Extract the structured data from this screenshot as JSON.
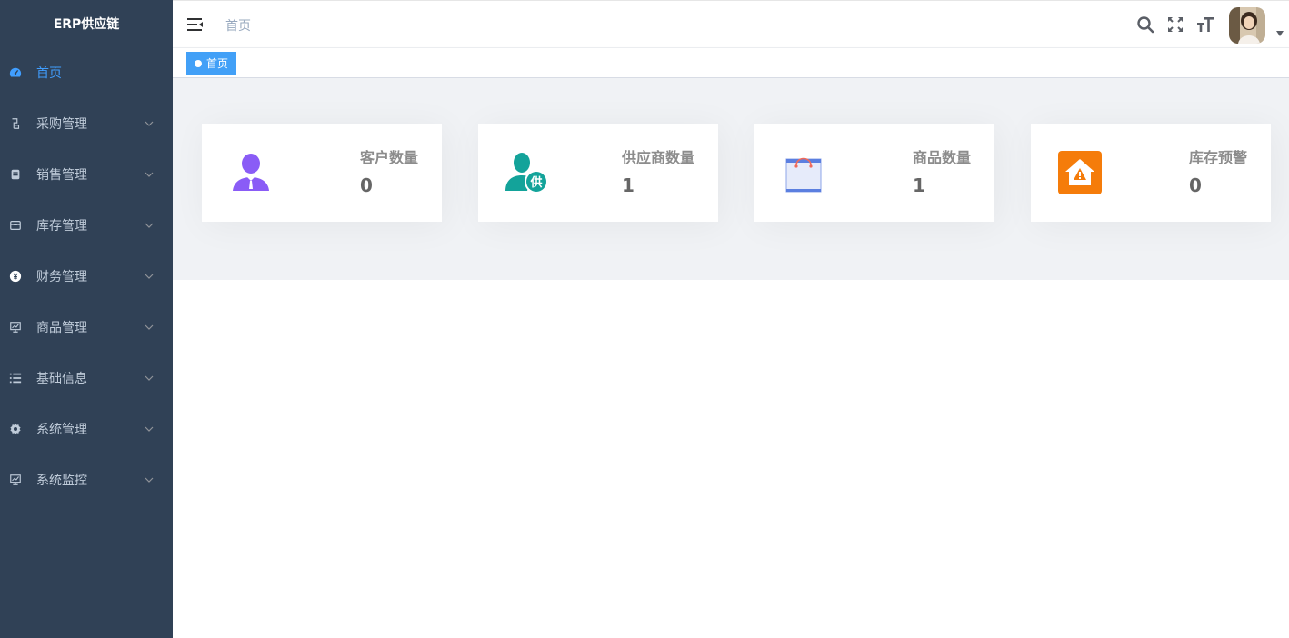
{
  "app": {
    "title": "ERP供应链"
  },
  "sidebar": {
    "items": [
      {
        "label": "首页",
        "icon": "dashboard-icon",
        "active": true
      },
      {
        "label": "采购管理",
        "icon": "purchase-icon"
      },
      {
        "label": "销售管理",
        "icon": "sales-icon"
      },
      {
        "label": "库存管理",
        "icon": "inventory-icon"
      },
      {
        "label": "财务管理",
        "icon": "finance-icon"
      },
      {
        "label": "商品管理",
        "icon": "goods-icon"
      },
      {
        "label": "基础信息",
        "icon": "list-icon"
      },
      {
        "label": "系统管理",
        "icon": "gear-icon"
      },
      {
        "label": "系统监控",
        "icon": "monitor-icon"
      }
    ]
  },
  "header": {
    "breadcrumb": "首页",
    "icons": [
      "search-icon",
      "fullscreen-icon",
      "font-size-icon"
    ]
  },
  "tags": {
    "active": "首页"
  },
  "cards": [
    {
      "label": "客户数量",
      "value": "0",
      "icon": "customer-icon",
      "color": "#8a5cf6"
    },
    {
      "label": "供应商数量",
      "value": "1",
      "icon": "supplier-icon",
      "color": "#13a39a"
    },
    {
      "label": "商品数量",
      "value": "1",
      "icon": "goods-bag-icon",
      "color": "#5b7fe0"
    },
    {
      "label": "库存预警",
      "value": "0",
      "icon": "stock-warning-icon",
      "color": "#f57c0a"
    }
  ],
  "colors": {
    "sidebar_bg": "#304156",
    "active": "#409eff",
    "tag_bg": "#42a0f7"
  }
}
